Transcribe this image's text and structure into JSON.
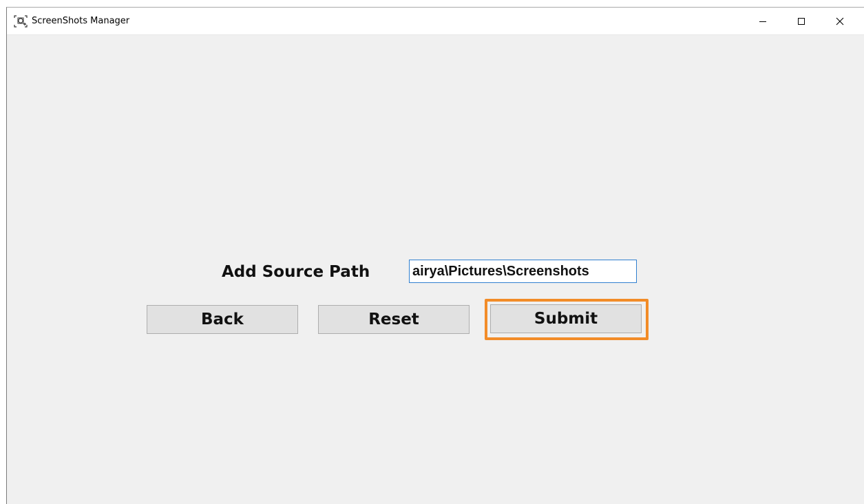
{
  "window": {
    "title": "ScreenShots Manager",
    "app_icon": "screenshot-capture-icon",
    "controls": {
      "minimize_icon": "minimize-icon",
      "maximize_icon": "maximize-icon",
      "close_icon": "close-icon"
    }
  },
  "form": {
    "source_label": "Add Source Path",
    "source_path_value": "airya\\Pictures\\Screenshots"
  },
  "buttons": {
    "back_label": "Back",
    "reset_label": "Reset",
    "submit_label": "Submit"
  },
  "colors": {
    "focus_highlight": "#f28c28",
    "input_border": "#2f7fd0",
    "window_background": "#f0f0f0"
  }
}
